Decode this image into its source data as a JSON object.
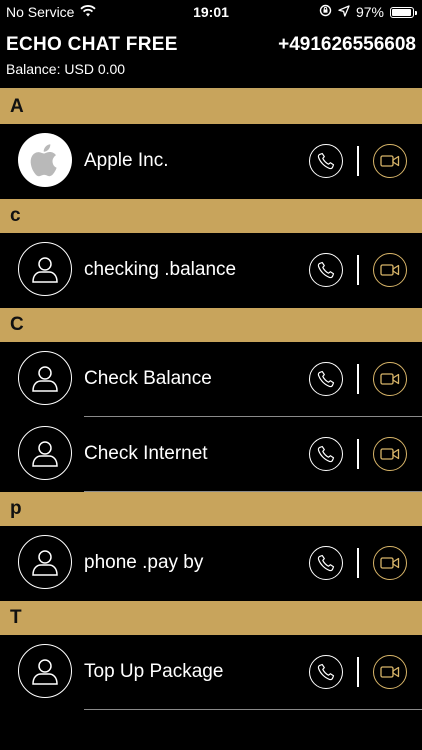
{
  "status_bar": {
    "carrier": "No Service",
    "time": "19:01",
    "battery": "97%",
    "battery_level": 0.97,
    "icons": [
      "wifi-icon",
      "orientation-lock-icon",
      "location-arrow-icon",
      "battery-icon"
    ]
  },
  "header": {
    "title": "ECHO CHAT FREE",
    "phone": "+491626556608",
    "balance": "Balance: USD 0.00"
  },
  "colors": {
    "background": "#000000",
    "section_header": "#c8a45c",
    "accent_gold": "#d8b569",
    "text": "#ffffff"
  },
  "sections": [
    {
      "letter": "A",
      "contacts": [
        {
          "name": "Apple Inc.",
          "avatar": "apple-logo"
        }
      ]
    },
    {
      "letter": "c",
      "contacts": [
        {
          "name": "checking .balance",
          "avatar": "person-icon"
        }
      ]
    },
    {
      "letter": "C",
      "contacts": [
        {
          "name": "Check Balance",
          "avatar": "person-icon"
        },
        {
          "name": "Check Internet",
          "avatar": "person-icon"
        }
      ]
    },
    {
      "letter": "p",
      "contacts": [
        {
          "name": "phone .pay by",
          "avatar": "person-icon"
        }
      ]
    },
    {
      "letter": "T",
      "contacts": [
        {
          "name": "Top Up Package",
          "avatar": "person-icon"
        }
      ]
    }
  ]
}
